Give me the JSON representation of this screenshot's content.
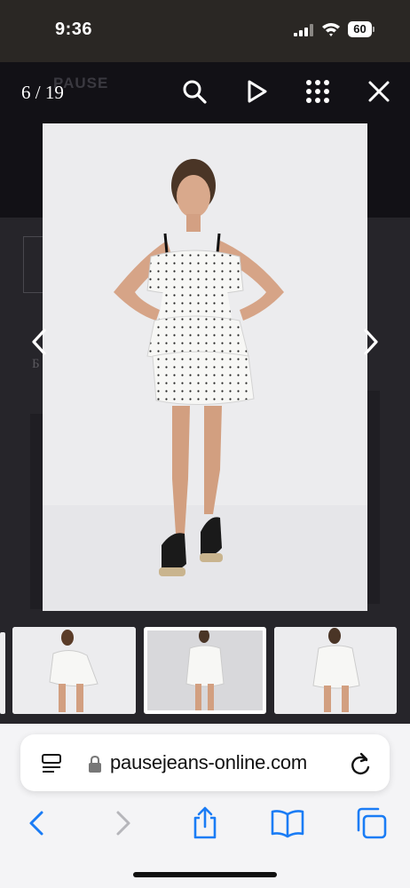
{
  "status_bar": {
    "time": "9:36",
    "battery": "60",
    "icons": [
      "signal-icon",
      "wifi-icon",
      "battery-icon"
    ]
  },
  "background_page": {
    "logo": "PAUSE",
    "letter": "Б"
  },
  "lightbox": {
    "counter": "6 / 19",
    "toolbar_icons": [
      "zoom-icon",
      "play-icon",
      "grid-icon",
      "close-icon"
    ],
    "nav_icons": [
      "prev-arrow-icon",
      "next-arrow-icon"
    ],
    "thumbnails": [
      {
        "name": "thumbnail-5",
        "active": false
      },
      {
        "name": "thumbnail-6",
        "active": true
      },
      {
        "name": "thumbnail-7",
        "active": false
      }
    ]
  },
  "safari": {
    "url": "pausejeans-online.com",
    "icons": [
      "reader-icon",
      "lock-icon",
      "reload-icon",
      "back-icon",
      "forward-icon",
      "share-icon",
      "bookmarks-icon",
      "tabs-icon"
    ]
  },
  "colors": {
    "overlay": "#2b2a2e",
    "photo_bg": "#ececee",
    "safari_accent": "#1a7cf5"
  }
}
